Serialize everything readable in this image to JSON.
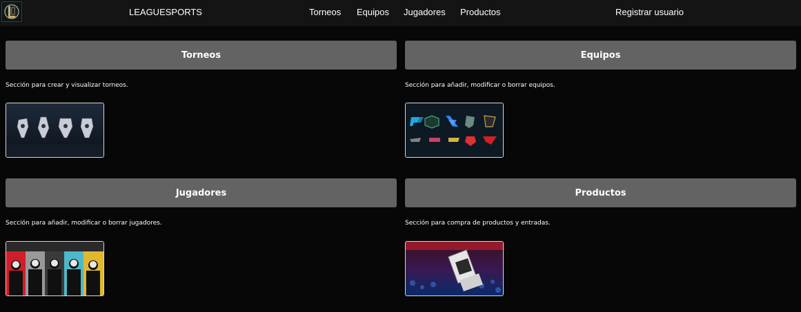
{
  "navbar": {
    "logo_icon": "league-of-legends-logo-icon",
    "brand": "LEAGUESPORTS",
    "links": [
      {
        "label": "Torneos"
      },
      {
        "label": "Equipos"
      },
      {
        "label": "Jugadores"
      },
      {
        "label": "Productos"
      }
    ],
    "register_label": "Registrar usuario"
  },
  "sections": [
    {
      "title": "Torneos",
      "description": "Sección para crear y visualizar torneos.",
      "image_icon": "tournament-trophies-image"
    },
    {
      "title": "Equipos",
      "description": "Sección para añadir, modificar o borrar equipos.",
      "image_icon": "team-logos-image"
    },
    {
      "title": "Jugadores",
      "description": "Sección para añadir, modificar o borrar jugadores.",
      "image_icon": "players-lineup-image"
    },
    {
      "title": "Productos",
      "description": "Sección para compra de productos y entradas.",
      "image_icon": "products-tickets-image"
    }
  ],
  "colors": {
    "background": "#070707",
    "navbar": "#141414",
    "card_header": "#636363",
    "thumb_border": "#d8d8d8"
  }
}
